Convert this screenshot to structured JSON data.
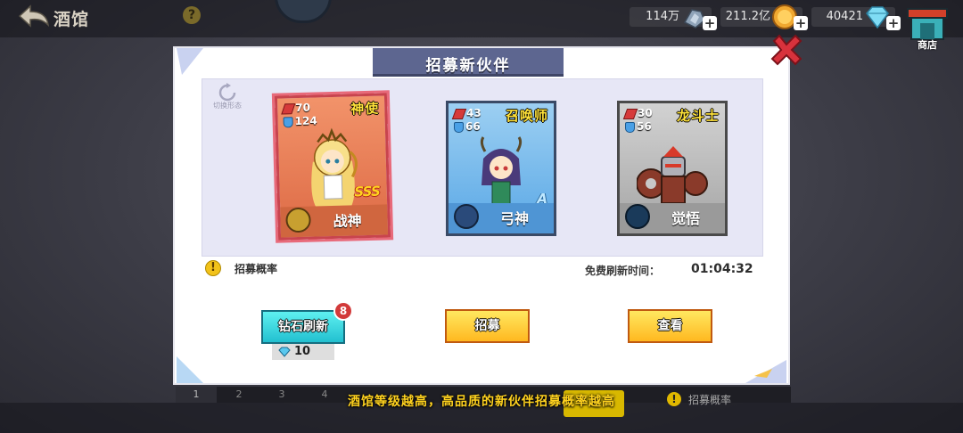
{
  "topbar": {
    "back_label": "酒馆",
    "help": "?",
    "resources": [
      {
        "value": "114万",
        "icon": "gear-metal-icon"
      },
      {
        "value": "211.2亿",
        "icon": "gold-coin-icon"
      },
      {
        "value": "40421",
        "icon": "diamond-icon"
      }
    ],
    "shop_label": "商店",
    "plus": "+"
  },
  "panel": {
    "title": "招募新伙伴",
    "switch_label": "切换形态",
    "cards": [
      {
        "attack": "70",
        "defense": "124",
        "class": "神使",
        "name": "战神",
        "rank": "SSS"
      },
      {
        "attack": "43",
        "defense": "66",
        "class": "召唤师",
        "name": "弓神",
        "rank": "A"
      },
      {
        "attack": "30",
        "defense": "56",
        "class": "龙斗士",
        "name": "觉悟",
        "rank": ""
      }
    ],
    "warn_icon": "!",
    "prob_label": "招募概率",
    "refresh_label": "免费刷新时间：",
    "refresh_time": "01:04:32",
    "diamond_refresh": {
      "label": "钻石刷新",
      "badge": "8",
      "cost": "10"
    },
    "recruit_label": "招募",
    "view_label": "查看"
  },
  "background": {
    "tabs": [
      "1",
      "2",
      "3",
      "4"
    ],
    "prob_label": "招募概率",
    "tip": "酒馆等级越高，高品质的新伙伴招募概率越高"
  },
  "colors": {
    "accent_yellow": "#ffd21f",
    "title_banner": "#5d6690",
    "cyan_button": "#22c0d0",
    "card_orange": "#dd6a45",
    "card_blue": "#5aa8e6",
    "card_gray": "#a5a5a5"
  }
}
